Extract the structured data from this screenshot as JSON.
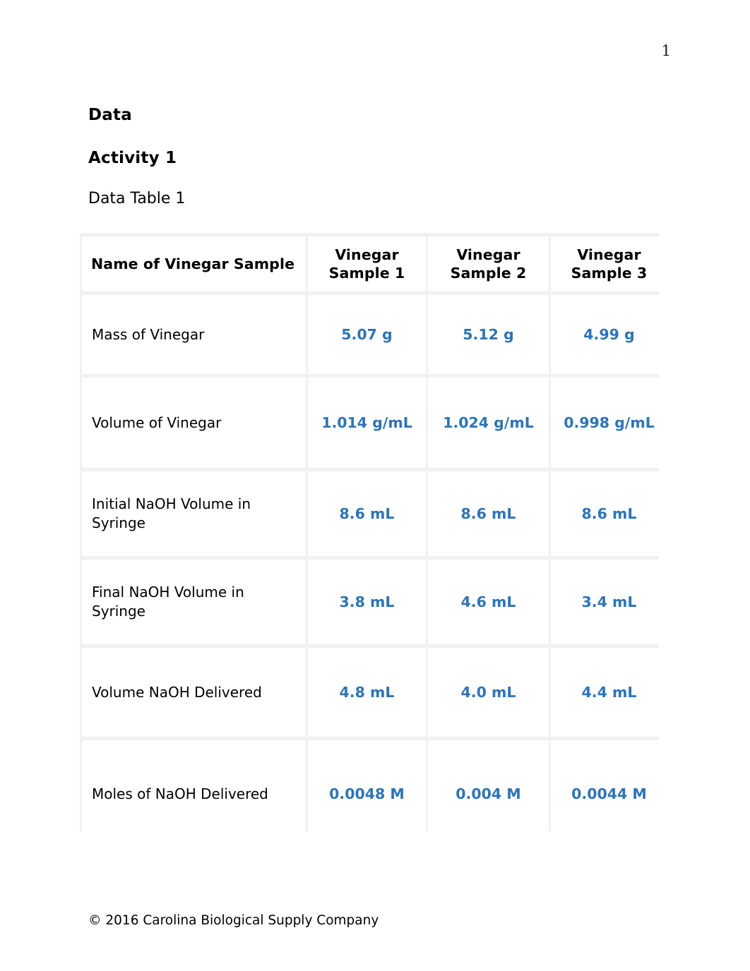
{
  "page": {
    "number": "1"
  },
  "headings": {
    "section": "Data",
    "activity": "Activity 1",
    "table_caption": "Data Table 1"
  },
  "colors": {
    "value_blue": "#2E74B5",
    "table_gridline": "#F1F1F1",
    "text_black": "#000000"
  },
  "table": {
    "columns": [
      "Name of Vinegar Sample",
      "Vinegar Sample 1",
      "Vinegar Sample 2",
      "Vinegar Sample 3"
    ],
    "column_header_lines": [
      [
        "Name of Vinegar Sample"
      ],
      [
        "Vinegar",
        "Sample 1"
      ],
      [
        "Vinegar",
        "Sample 2"
      ],
      [
        "Vinegar",
        "Sample 3"
      ]
    ],
    "rows": [
      {
        "label": "Mass of Vinegar",
        "label_lines": [
          "Mass of Vinegar"
        ],
        "values": [
          "5.07 g",
          "5.12 g",
          "4.99 g"
        ]
      },
      {
        "label": "Volume of Vinegar",
        "label_lines": [
          "Volume of Vinegar"
        ],
        "values": [
          "1.014 g/mL",
          "1.024 g/mL",
          "0.998 g/mL"
        ]
      },
      {
        "label": "Initial NaOH Volume in Syringe",
        "label_lines": [
          "Initial NaOH Volume in",
          "Syringe"
        ],
        "values": [
          "8.6 mL",
          "8.6 mL",
          "8.6 mL"
        ]
      },
      {
        "label": "Final NaOH Volume in Syringe",
        "label_lines": [
          "Final NaOH Volume in",
          "Syringe"
        ],
        "values": [
          "3.8 mL",
          "4.6 mL",
          "3.4 mL"
        ]
      },
      {
        "label": "Volume NaOH Delivered",
        "label_lines": [
          "Volume NaOH Delivered"
        ],
        "values": [
          "4.8 mL",
          "4.0 mL",
          "4.4 mL"
        ]
      },
      {
        "label": "Moles of NaOH Delivered",
        "label_lines": [
          "Moles of NaOH Delivered"
        ],
        "values": [
          "0.0048 M",
          "0.004 M",
          "0.0044 M"
        ]
      }
    ]
  },
  "footer": {
    "copyright": "© 2016 Carolina Biological Supply Company"
  }
}
